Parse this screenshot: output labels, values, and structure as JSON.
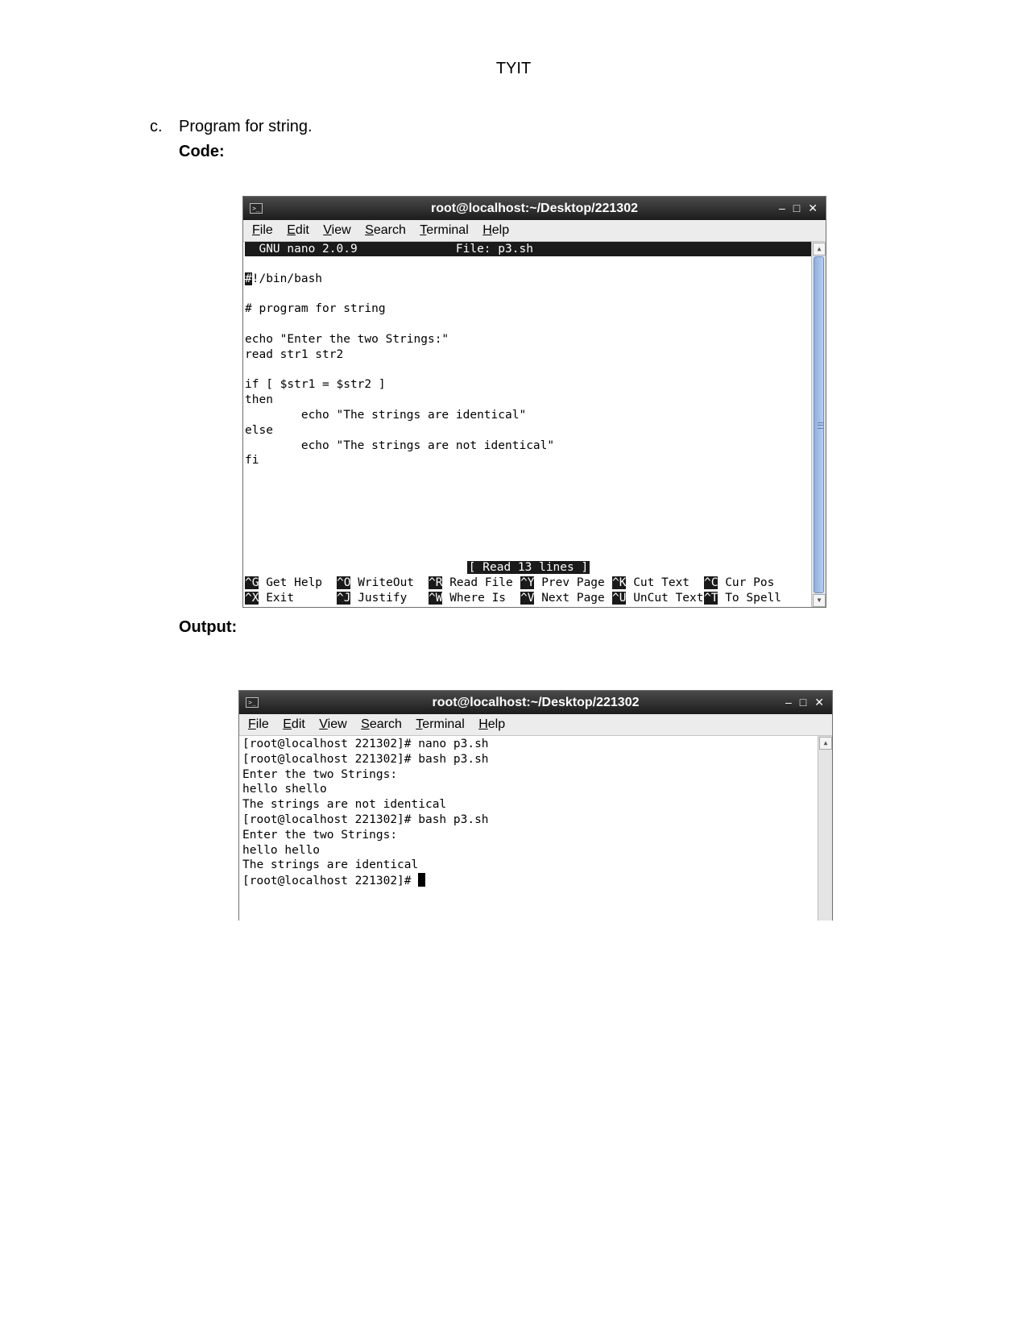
{
  "header": "TYIT",
  "section": {
    "letter": "c.",
    "title": "Program for string."
  },
  "code_heading": "Code:",
  "output_heading": "Output:",
  "terminal1": {
    "title": "root@localhost:~/Desktop/221302",
    "menu": [
      {
        "ul": "F",
        "rest": "ile"
      },
      {
        "ul": "E",
        "rest": "dit"
      },
      {
        "ul": "V",
        "rest": "iew"
      },
      {
        "ul": "S",
        "rest": "earch"
      },
      {
        "ul": "T",
        "rest": "erminal"
      },
      {
        "ul": "H",
        "rest": "elp"
      }
    ],
    "nano_header": "  GNU nano 2.0.9              File: p3.sh",
    "first_char": "#",
    "first_line_rest": "!/bin/bash",
    "code_lines": [
      "",
      "# program for string",
      "",
      "echo \"Enter the two Strings:\"",
      "read str1 str2",
      "",
      "if [ $str1 = $str2 ]",
      "then",
      "        echo \"The strings are identical\"",
      "else",
      "        echo \"The strings are not identical\"",
      "fi"
    ],
    "status": "[ Read 13 lines ]",
    "shortcuts_row1": [
      {
        "key": "^G",
        "label": " Get Help"
      },
      {
        "key": "^O",
        "label": " WriteOut"
      },
      {
        "key": "^R",
        "label": " Read File"
      },
      {
        "key": "^Y",
        "label": " Prev Page"
      },
      {
        "key": "^K",
        "label": " Cut Text"
      },
      {
        "key": "^C",
        "label": " Cur Pos"
      }
    ],
    "shortcuts_row2": [
      {
        "key": "^X",
        "label": " Exit"
      },
      {
        "key": "^J",
        "label": " Justify"
      },
      {
        "key": "^W",
        "label": " Where Is"
      },
      {
        "key": "^V",
        "label": " Next Page"
      },
      {
        "key": "^U",
        "label": " UnCut Text"
      },
      {
        "key": "^T",
        "label": " To Spell"
      }
    ]
  },
  "terminal2": {
    "title": "root@localhost:~/Desktop/221302",
    "menu": [
      {
        "ul": "F",
        "rest": "ile"
      },
      {
        "ul": "E",
        "rest": "dit"
      },
      {
        "ul": "V",
        "rest": "iew"
      },
      {
        "ul": "S",
        "rest": "earch"
      },
      {
        "ul": "T",
        "rest": "erminal"
      },
      {
        "ul": "H",
        "rest": "elp"
      }
    ],
    "lines": [
      "[root@localhost 221302]# nano p3.sh",
      "[root@localhost 221302]# bash p3.sh",
      "Enter the two Strings:",
      "hello shello",
      "The strings are not identical",
      "[root@localhost 221302]# bash p3.sh",
      "Enter the two Strings:",
      "hello hello",
      "The strings are identical"
    ],
    "prompt": "[root@localhost 221302]# "
  }
}
